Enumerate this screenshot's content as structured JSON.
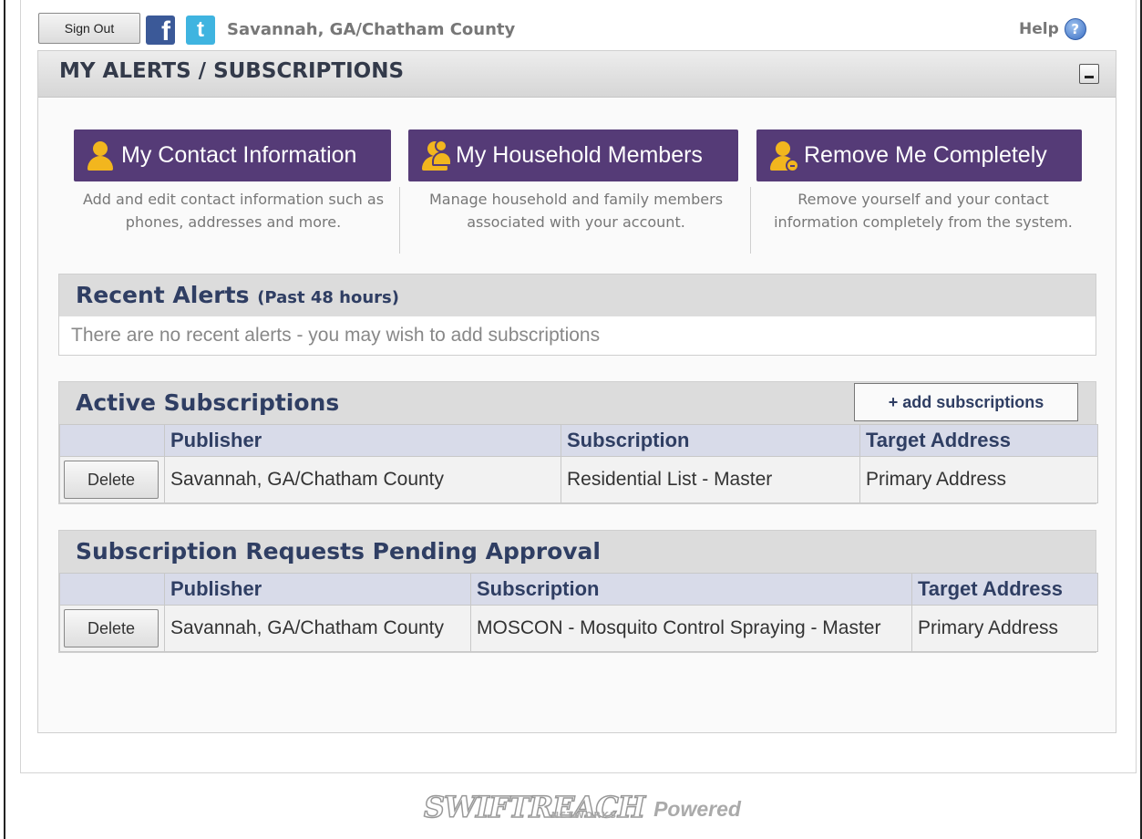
{
  "topbar": {
    "sign_out_label": "Sign Out",
    "facebook_glyph": "f",
    "twitter_glyph": "t",
    "org_name": "Savannah, GA/Chatham County",
    "help_label": "Help",
    "help_glyph": "?"
  },
  "panel": {
    "title": "MY ALERTS / SUBSCRIPTIONS"
  },
  "actions": [
    {
      "label": "My Contact Information",
      "icon": "person-icon",
      "description": "Add and edit contact information such as phones, addresses and more."
    },
    {
      "label": "My Household Members",
      "icon": "people-icon",
      "description": "Manage household and family members associated with your account."
    },
    {
      "label": "Remove Me Completely",
      "icon": "person-remove-icon",
      "description": "Remove yourself and your contact information completely from the system."
    }
  ],
  "recent_alerts": {
    "title": "Recent Alerts",
    "title_note": "(Past 48 hours)",
    "empty_text": "There are no recent alerts - you may wish to add subscriptions"
  },
  "active_subscriptions": {
    "title": "Active Subscriptions",
    "add_label": "+ add subscriptions",
    "headers": [
      "",
      "Publisher",
      "Subscription",
      "Target Address"
    ],
    "rows": [
      {
        "delete_label": "Delete",
        "publisher": "Savannah, GA/Chatham County",
        "subscription": "Residential List - Master",
        "target": "Primary Address"
      }
    ]
  },
  "pending": {
    "title": "Subscription Requests Pending Approval",
    "headers": [
      "",
      "Publisher",
      "Subscription",
      "Target Address"
    ],
    "rows": [
      {
        "delete_label": "Delete",
        "publisher": "Savannah, GA/Chatham County",
        "subscription": "MOSCON - Mosquito Control Spraying - Master",
        "target": "Primary Address"
      }
    ]
  },
  "footer": {
    "brand": "SWIFTREACH",
    "brand_sub": "NETWORKS",
    "powered": "Powered"
  },
  "colors": {
    "action_button": "#553b77",
    "icon_gold": "#f2b61e",
    "section_title": "#2f3e63",
    "table_header": "#d8dbe9"
  }
}
